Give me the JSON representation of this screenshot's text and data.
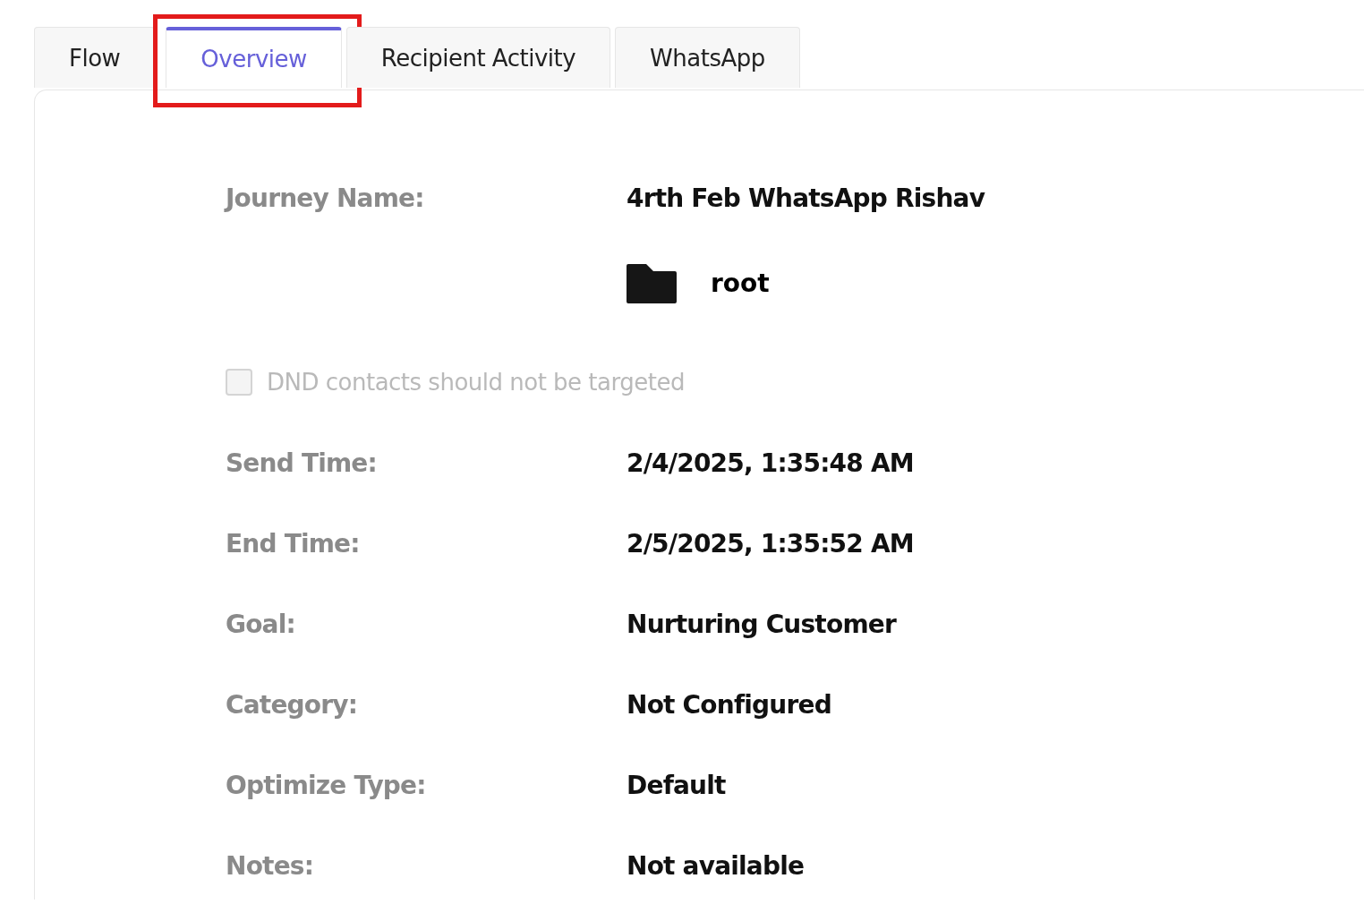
{
  "tabs": [
    {
      "label": "Flow",
      "selected": false,
      "highlighted": false
    },
    {
      "label": "Overview",
      "selected": true,
      "highlighted": true
    },
    {
      "label": "Recipient Activity",
      "selected": false,
      "highlighted": false
    },
    {
      "label": "WhatsApp",
      "selected": false,
      "highlighted": false
    }
  ],
  "overview": {
    "journey_name": {
      "label": "Journey Name:",
      "value": "4rth Feb WhatsApp Rishav"
    },
    "folder": "root",
    "dnd_checkbox": {
      "label": "DND contacts should not be targeted",
      "checked": false,
      "disabled": true
    },
    "fields": [
      {
        "label": "Send Time:",
        "value": "2/4/2025, 1:35:48 AM"
      },
      {
        "label": "End Time:",
        "value": "2/5/2025, 1:35:52 AM"
      },
      {
        "label": "Goal:",
        "value": "Nurturing Customer"
      },
      {
        "label": "Category:",
        "value": "Not Configured"
      },
      {
        "label": "Optimize Type:",
        "value": "Default"
      },
      {
        "label": "Notes:",
        "value": "Not available"
      }
    ]
  }
}
